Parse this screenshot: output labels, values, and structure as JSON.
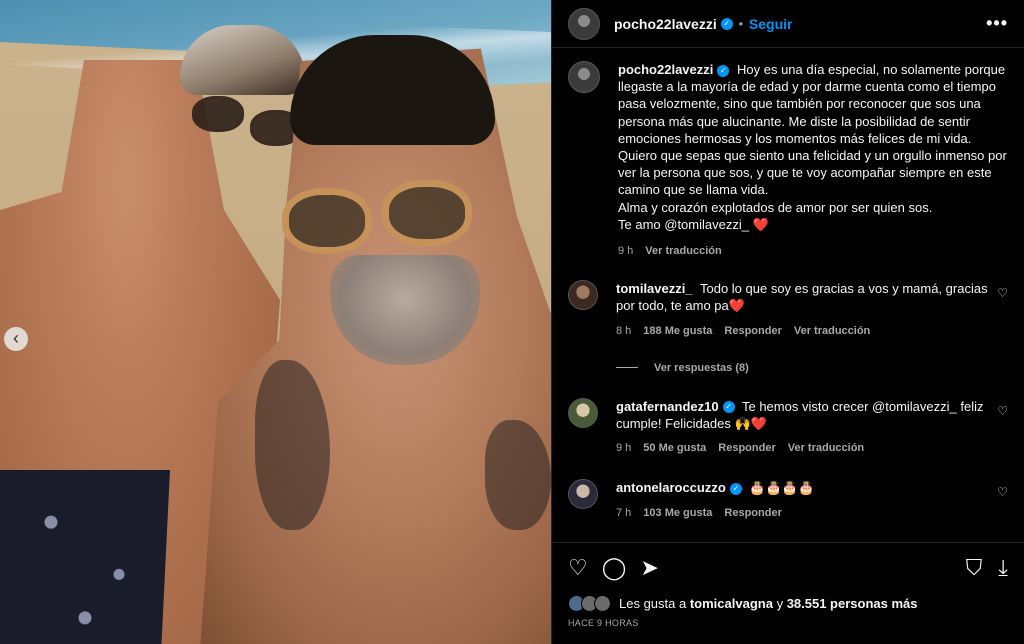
{
  "post": {
    "author": "pocho22lavezzi",
    "follow_label": "Seguir",
    "dot": "•",
    "more": "•••",
    "carousel_prev": "‹"
  },
  "caption": {
    "username": "pocho22lavezzi",
    "text": "Hoy es una día especial, no solamente porque llegaste a la mayoría de edad y por darme cuenta como el tiempo pasa velozmente, sino que también por reconocer que sos una persona más que alucinante. Me diste la posibilidad de sentir emociones hermosas y los momentos más felices de mi vida. Quiero que sepas que siento una felicidad y un orgullo inmenso por ver la persona que sos, y que te voy acompañar siempre en este camino que se llama vida.",
    "line2": "Alma y corazón explotados de amor por ser quien sos.",
    "line3": "Te amo @tomilavezzi_ ❤️",
    "time": "9 h",
    "translate": "Ver traducción"
  },
  "comments": [
    {
      "username": "tomilavezzi_",
      "text": "Todo lo que soy es gracias a vos y mamá, gracias por todo, te amo pa❤️",
      "time": "8 h",
      "likes": "188 Me gusta",
      "reply": "Responder",
      "translate": "Ver traducción",
      "replies": "Ver respuestas (8)"
    },
    {
      "username": "gatafernandez10",
      "text": "Te hemos visto crecer @tomilavezzi_ feliz cumple! Felicidades 🙌❤️",
      "time": "9 h",
      "likes": "50 Me gusta",
      "reply": "Responder",
      "translate": "Ver traducción"
    },
    {
      "username": "antonelaroccuzzo",
      "text": "🎂🎂🎂🎂",
      "time": "7 h",
      "likes": "103 Me gusta",
      "reply": "Responder"
    }
  ],
  "likes": {
    "prefix": "Les gusta a",
    "user": "tomicalvagna",
    "middle": "y",
    "count": "38.551 personas más"
  },
  "time_ago": "HACE 9 HORAS",
  "icons": {
    "heart": "♡",
    "comment": "◯",
    "share": "➤",
    "save": "⛉",
    "download": "⤓",
    "verified": "✓"
  }
}
